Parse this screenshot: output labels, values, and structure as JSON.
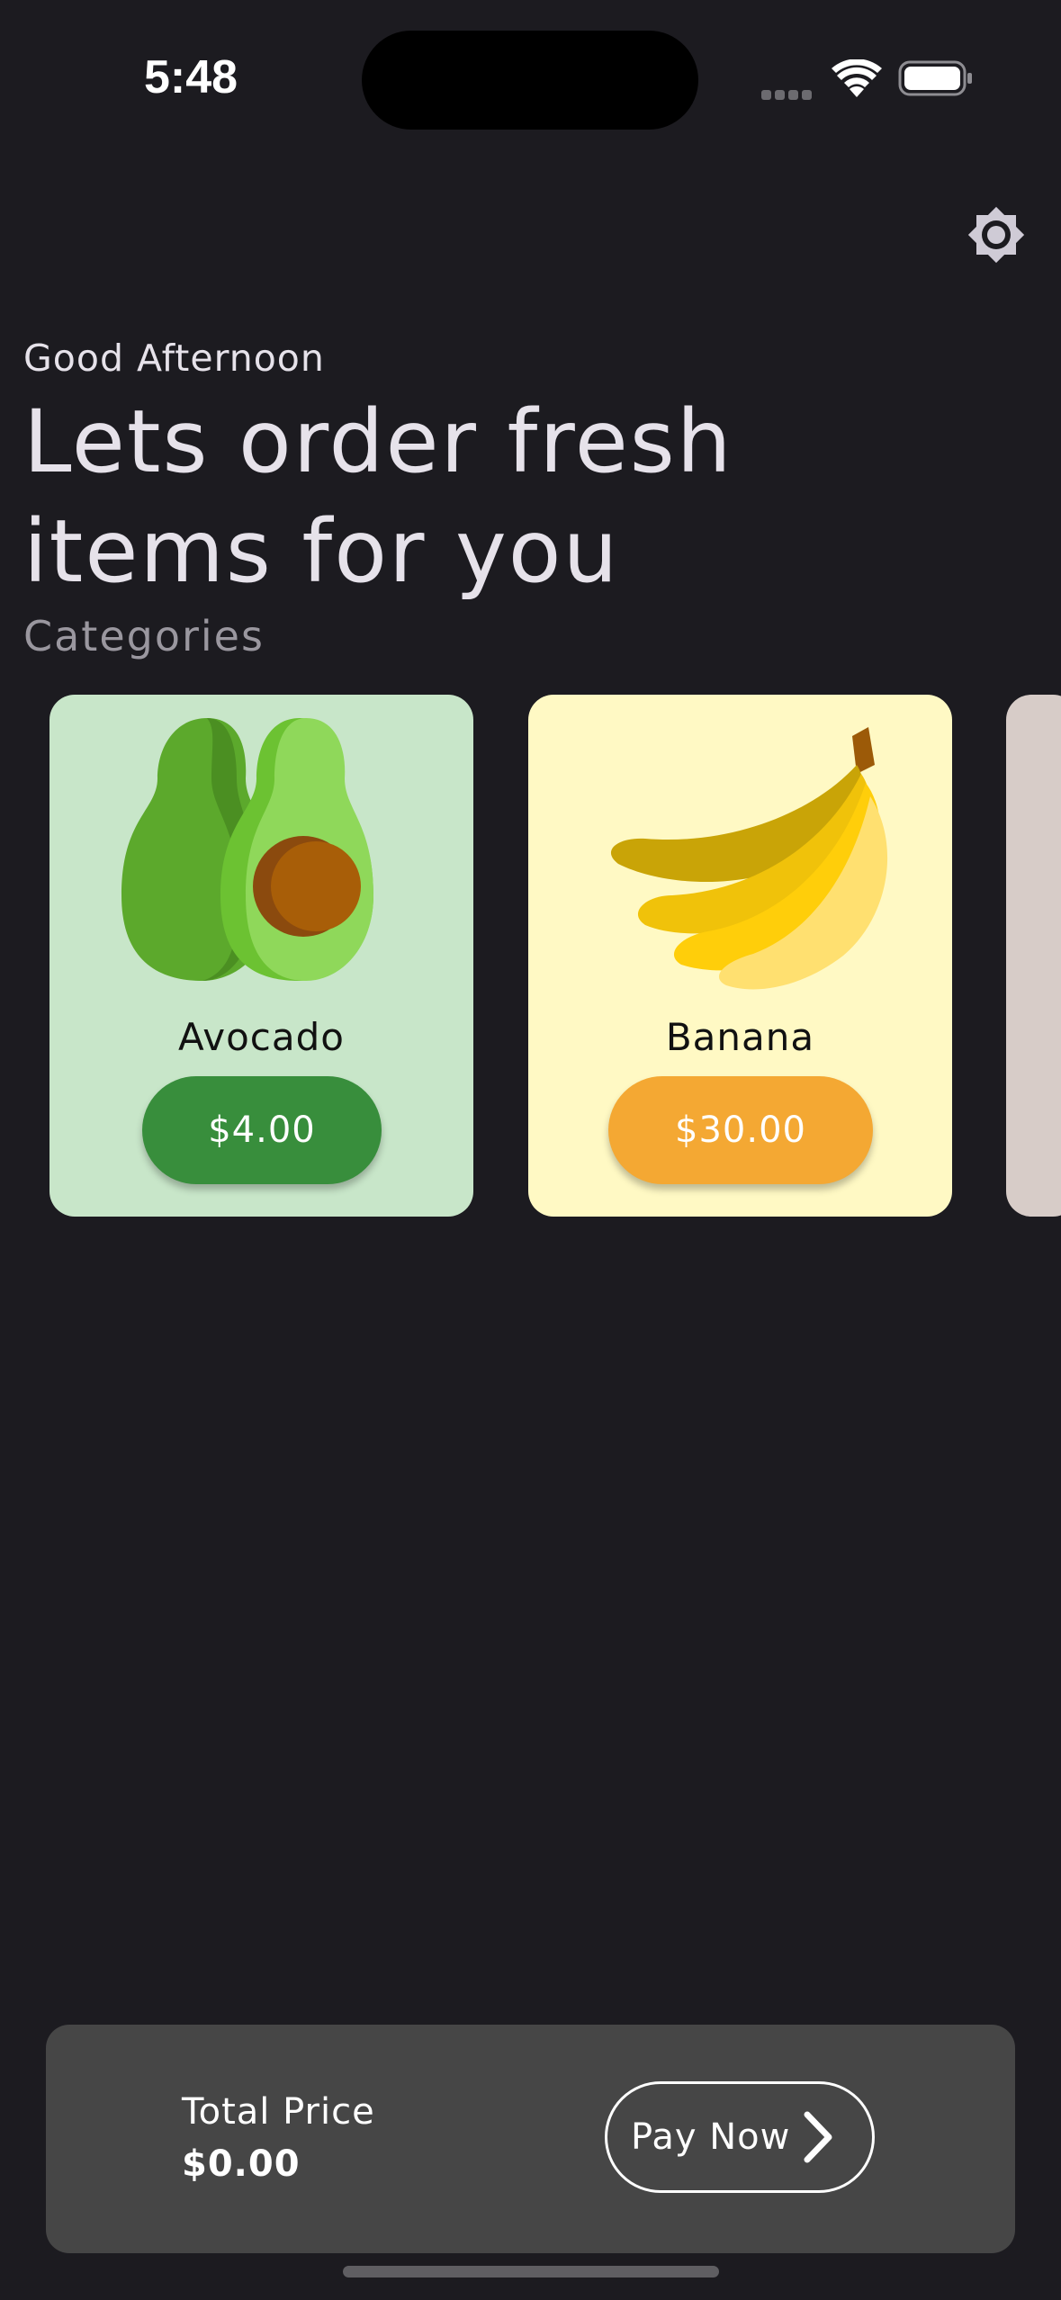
{
  "status_bar": {
    "time": "5:48"
  },
  "header": {
    "theme_toggle_icon": "brightness-gear-icon"
  },
  "greeting": "Good Afternoon",
  "headline_line1": "Lets order fresh",
  "headline_line2": "items for you",
  "section_title": "Categories",
  "products": [
    {
      "name": "Avocado",
      "price": "$4.00",
      "icon": "avocado-icon",
      "card_color": "#c8e6c9",
      "button_color": "#388e3c"
    },
    {
      "name": "Banana",
      "price": "$30.00",
      "icon": "banana-icon",
      "card_color": "#fff9c4",
      "button_color": "#f4a833"
    }
  ],
  "checkout": {
    "total_label": "Total Price",
    "total_value": "$0.00",
    "pay_label": "Pay Now",
    "pay_icon": "chevron-right-icon"
  }
}
